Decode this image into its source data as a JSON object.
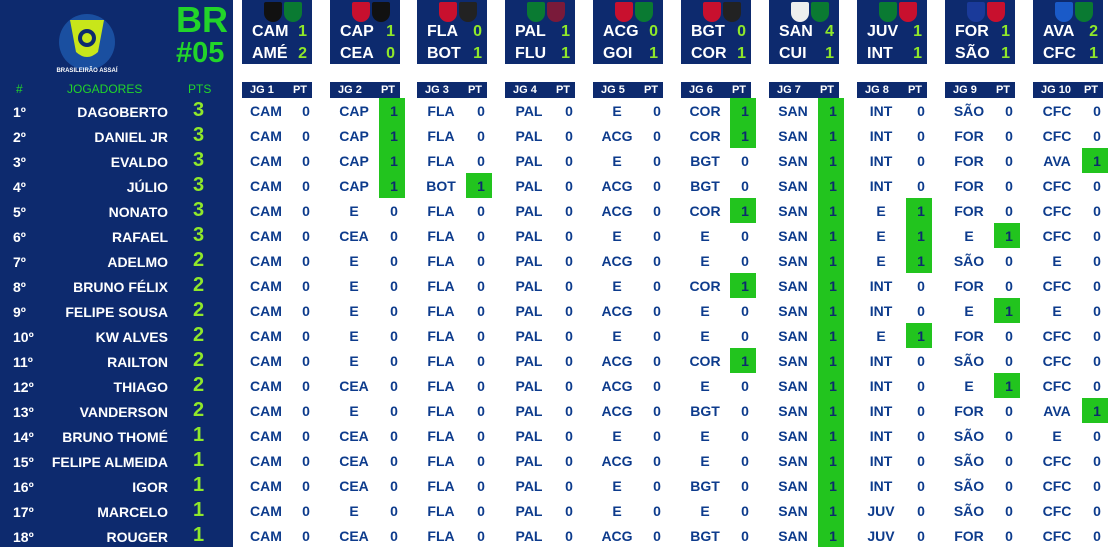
{
  "brand": {
    "logo_text": "BRASILEIRÃO ASSAÍ",
    "round_prefix": "BR",
    "round_number": "#05"
  },
  "colors": {
    "panel": "#0d2a6e",
    "accent": "#22d42a",
    "points": "#8fe82a",
    "cell_text": "#0d3b8c",
    "hit": "#22c41e"
  },
  "headers": {
    "pos": "#",
    "players": "JOGADORES",
    "pts": "PTS",
    "pt": "PT"
  },
  "matches": [
    {
      "jg": "JG 1",
      "home": "CAM",
      "home_score": "1",
      "away": "AMÉ",
      "away_score": "2",
      "crests": [
        "#111111",
        "#0a7a32"
      ]
    },
    {
      "jg": "JG 2",
      "home": "CAP",
      "home_score": "1",
      "away": "CEA",
      "away_score": "0",
      "crests": [
        "#c8102e",
        "#111111"
      ]
    },
    {
      "jg": "JG 3",
      "home": "FLA",
      "home_score": "0",
      "away": "BOT",
      "away_score": "1",
      "crests": [
        "#c8102e",
        "#222222"
      ]
    },
    {
      "jg": "JG 4",
      "home": "PAL",
      "home_score": "1",
      "away": "FLU",
      "away_score": "1",
      "crests": [
        "#0a7a32",
        "#7a1a3a"
      ]
    },
    {
      "jg": "JG 5",
      "home": "ACG",
      "home_score": "0",
      "away": "GOI",
      "away_score": "1",
      "crests": [
        "#c8102e",
        "#0a7a32"
      ]
    },
    {
      "jg": "JG 6",
      "home": "BGT",
      "home_score": "0",
      "away": "COR",
      "away_score": "1",
      "crests": [
        "#c8102e",
        "#222222"
      ]
    },
    {
      "jg": "JG 7",
      "home": "SAN",
      "home_score": "4",
      "away": "CUI",
      "away_score": "1",
      "crests": [
        "#eeeeee",
        "#0a7a32"
      ]
    },
    {
      "jg": "JG 8",
      "home": "JUV",
      "home_score": "1",
      "away": "INT",
      "away_score": "1",
      "crests": [
        "#0a7a32",
        "#c8102e"
      ]
    },
    {
      "jg": "JG 9",
      "home": "FOR",
      "home_score": "1",
      "away": "SÃO",
      "away_score": "1",
      "crests": [
        "#1a3a9a",
        "#c8102e"
      ]
    },
    {
      "jg": "JG 10",
      "home": "AVA",
      "home_score": "2",
      "away": "CFC",
      "away_score": "1",
      "crests": [
        "#1a5ac8",
        "#0a7a32"
      ]
    }
  ],
  "players": [
    {
      "pos": "1º",
      "name": "DAGOBERTO",
      "pts": "3",
      "picks": [
        [
          "CAM",
          "0"
        ],
        [
          "CAP",
          "1"
        ],
        [
          "FLA",
          "0"
        ],
        [
          "PAL",
          "0"
        ],
        [
          "E",
          "0"
        ],
        [
          "COR",
          "1"
        ],
        [
          "SAN",
          "1"
        ],
        [
          "INT",
          "0"
        ],
        [
          "SÃO",
          "0"
        ],
        [
          "CFC",
          "0"
        ]
      ]
    },
    {
      "pos": "2º",
      "name": "DANIEL JR",
      "pts": "3",
      "picks": [
        [
          "CAM",
          "0"
        ],
        [
          "CAP",
          "1"
        ],
        [
          "FLA",
          "0"
        ],
        [
          "PAL",
          "0"
        ],
        [
          "ACG",
          "0"
        ],
        [
          "COR",
          "1"
        ],
        [
          "SAN",
          "1"
        ],
        [
          "INT",
          "0"
        ],
        [
          "FOR",
          "0"
        ],
        [
          "CFC",
          "0"
        ]
      ]
    },
    {
      "pos": "3º",
      "name": "EVALDO",
      "pts": "3",
      "picks": [
        [
          "CAM",
          "0"
        ],
        [
          "CAP",
          "1"
        ],
        [
          "FLA",
          "0"
        ],
        [
          "PAL",
          "0"
        ],
        [
          "E",
          "0"
        ],
        [
          "BGT",
          "0"
        ],
        [
          "SAN",
          "1"
        ],
        [
          "INT",
          "0"
        ],
        [
          "FOR",
          "0"
        ],
        [
          "AVA",
          "1"
        ]
      ]
    },
    {
      "pos": "4º",
      "name": "JÚLIO",
      "pts": "3",
      "picks": [
        [
          "CAM",
          "0"
        ],
        [
          "CAP",
          "1"
        ],
        [
          "BOT",
          "1"
        ],
        [
          "PAL",
          "0"
        ],
        [
          "ACG",
          "0"
        ],
        [
          "BGT",
          "0"
        ],
        [
          "SAN",
          "1"
        ],
        [
          "INT",
          "0"
        ],
        [
          "FOR",
          "0"
        ],
        [
          "CFC",
          "0"
        ]
      ]
    },
    {
      "pos": "5º",
      "name": "NONATO",
      "pts": "3",
      "picks": [
        [
          "CAM",
          "0"
        ],
        [
          "E",
          "0"
        ],
        [
          "FLA",
          "0"
        ],
        [
          "PAL",
          "0"
        ],
        [
          "ACG",
          "0"
        ],
        [
          "COR",
          "1"
        ],
        [
          "SAN",
          "1"
        ],
        [
          "E",
          "1"
        ],
        [
          "FOR",
          "0"
        ],
        [
          "CFC",
          "0"
        ]
      ]
    },
    {
      "pos": "6º",
      "name": "RAFAEL",
      "pts": "3",
      "picks": [
        [
          "CAM",
          "0"
        ],
        [
          "CEA",
          "0"
        ],
        [
          "FLA",
          "0"
        ],
        [
          "PAL",
          "0"
        ],
        [
          "E",
          "0"
        ],
        [
          "E",
          "0"
        ],
        [
          "SAN",
          "1"
        ],
        [
          "E",
          "1"
        ],
        [
          "E",
          "1"
        ],
        [
          "CFC",
          "0"
        ]
      ]
    },
    {
      "pos": "7º",
      "name": "ADELMO",
      "pts": "2",
      "picks": [
        [
          "CAM",
          "0"
        ],
        [
          "E",
          "0"
        ],
        [
          "FLA",
          "0"
        ],
        [
          "PAL",
          "0"
        ],
        [
          "ACG",
          "0"
        ],
        [
          "E",
          "0"
        ],
        [
          "SAN",
          "1"
        ],
        [
          "E",
          "1"
        ],
        [
          "SÃO",
          "0"
        ],
        [
          "E",
          "0"
        ]
      ]
    },
    {
      "pos": "8º",
      "name": "BRUNO FÉLIX",
      "pts": "2",
      "picks": [
        [
          "CAM",
          "0"
        ],
        [
          "E",
          "0"
        ],
        [
          "FLA",
          "0"
        ],
        [
          "PAL",
          "0"
        ],
        [
          "E",
          "0"
        ],
        [
          "COR",
          "1"
        ],
        [
          "SAN",
          "1"
        ],
        [
          "INT",
          "0"
        ],
        [
          "FOR",
          "0"
        ],
        [
          "CFC",
          "0"
        ]
      ]
    },
    {
      "pos": "9º",
      "name": "FELIPE SOUSA",
      "pts": "2",
      "picks": [
        [
          "CAM",
          "0"
        ],
        [
          "E",
          "0"
        ],
        [
          "FLA",
          "0"
        ],
        [
          "PAL",
          "0"
        ],
        [
          "ACG",
          "0"
        ],
        [
          "E",
          "0"
        ],
        [
          "SAN",
          "1"
        ],
        [
          "INT",
          "0"
        ],
        [
          "E",
          "1"
        ],
        [
          "E",
          "0"
        ]
      ]
    },
    {
      "pos": "10º",
      "name": "KW ALVES",
      "pts": "2",
      "picks": [
        [
          "CAM",
          "0"
        ],
        [
          "E",
          "0"
        ],
        [
          "FLA",
          "0"
        ],
        [
          "PAL",
          "0"
        ],
        [
          "E",
          "0"
        ],
        [
          "E",
          "0"
        ],
        [
          "SAN",
          "1"
        ],
        [
          "E",
          "1"
        ],
        [
          "FOR",
          "0"
        ],
        [
          "CFC",
          "0"
        ]
      ]
    },
    {
      "pos": "11º",
      "name": "RAILTON",
      "pts": "2",
      "picks": [
        [
          "CAM",
          "0"
        ],
        [
          "E",
          "0"
        ],
        [
          "FLA",
          "0"
        ],
        [
          "PAL",
          "0"
        ],
        [
          "ACG",
          "0"
        ],
        [
          "COR",
          "1"
        ],
        [
          "SAN",
          "1"
        ],
        [
          "INT",
          "0"
        ],
        [
          "SÃO",
          "0"
        ],
        [
          "CFC",
          "0"
        ]
      ]
    },
    {
      "pos": "12º",
      "name": "THIAGO",
      "pts": "2",
      "picks": [
        [
          "CAM",
          "0"
        ],
        [
          "CEA",
          "0"
        ],
        [
          "FLA",
          "0"
        ],
        [
          "PAL",
          "0"
        ],
        [
          "ACG",
          "0"
        ],
        [
          "E",
          "0"
        ],
        [
          "SAN",
          "1"
        ],
        [
          "INT",
          "0"
        ],
        [
          "E",
          "1"
        ],
        [
          "CFC",
          "0"
        ]
      ]
    },
    {
      "pos": "13º",
      "name": "VANDERSON",
      "pts": "2",
      "picks": [
        [
          "CAM",
          "0"
        ],
        [
          "E",
          "0"
        ],
        [
          "FLA",
          "0"
        ],
        [
          "PAL",
          "0"
        ],
        [
          "ACG",
          "0"
        ],
        [
          "BGT",
          "0"
        ],
        [
          "SAN",
          "1"
        ],
        [
          "INT",
          "0"
        ],
        [
          "FOR",
          "0"
        ],
        [
          "AVA",
          "1"
        ]
      ]
    },
    {
      "pos": "14º",
      "name": "BRUNO THOMÉ",
      "pts": "1",
      "picks": [
        [
          "CAM",
          "0"
        ],
        [
          "CEA",
          "0"
        ],
        [
          "FLA",
          "0"
        ],
        [
          "PAL",
          "0"
        ],
        [
          "E",
          "0"
        ],
        [
          "E",
          "0"
        ],
        [
          "SAN",
          "1"
        ],
        [
          "INT",
          "0"
        ],
        [
          "SÃO",
          "0"
        ],
        [
          "E",
          "0"
        ]
      ]
    },
    {
      "pos": "15º",
      "name": "FELIPE ALMEIDA",
      "pts": "1",
      "picks": [
        [
          "CAM",
          "0"
        ],
        [
          "CEA",
          "0"
        ],
        [
          "FLA",
          "0"
        ],
        [
          "PAL",
          "0"
        ],
        [
          "ACG",
          "0"
        ],
        [
          "E",
          "0"
        ],
        [
          "SAN",
          "1"
        ],
        [
          "INT",
          "0"
        ],
        [
          "SÃO",
          "0"
        ],
        [
          "CFC",
          "0"
        ]
      ]
    },
    {
      "pos": "16º",
      "name": "IGOR",
      "pts": "1",
      "picks": [
        [
          "CAM",
          "0"
        ],
        [
          "CEA",
          "0"
        ],
        [
          "FLA",
          "0"
        ],
        [
          "PAL",
          "0"
        ],
        [
          "E",
          "0"
        ],
        [
          "BGT",
          "0"
        ],
        [
          "SAN",
          "1"
        ],
        [
          "INT",
          "0"
        ],
        [
          "SÃO",
          "0"
        ],
        [
          "CFC",
          "0"
        ]
      ]
    },
    {
      "pos": "17º",
      "name": "MARCELO",
      "pts": "1",
      "picks": [
        [
          "CAM",
          "0"
        ],
        [
          "E",
          "0"
        ],
        [
          "FLA",
          "0"
        ],
        [
          "PAL",
          "0"
        ],
        [
          "E",
          "0"
        ],
        [
          "E",
          "0"
        ],
        [
          "SAN",
          "1"
        ],
        [
          "JUV",
          "0"
        ],
        [
          "SÃO",
          "0"
        ],
        [
          "CFC",
          "0"
        ]
      ]
    },
    {
      "pos": "18º",
      "name": "ROUGER",
      "pts": "1",
      "picks": [
        [
          "CAM",
          "0"
        ],
        [
          "CEA",
          "0"
        ],
        [
          "FLA",
          "0"
        ],
        [
          "PAL",
          "0"
        ],
        [
          "ACG",
          "0"
        ],
        [
          "BGT",
          "0"
        ],
        [
          "SAN",
          "1"
        ],
        [
          "JUV",
          "0"
        ],
        [
          "FOR",
          "0"
        ],
        [
          "CFC",
          "0"
        ]
      ]
    }
  ]
}
